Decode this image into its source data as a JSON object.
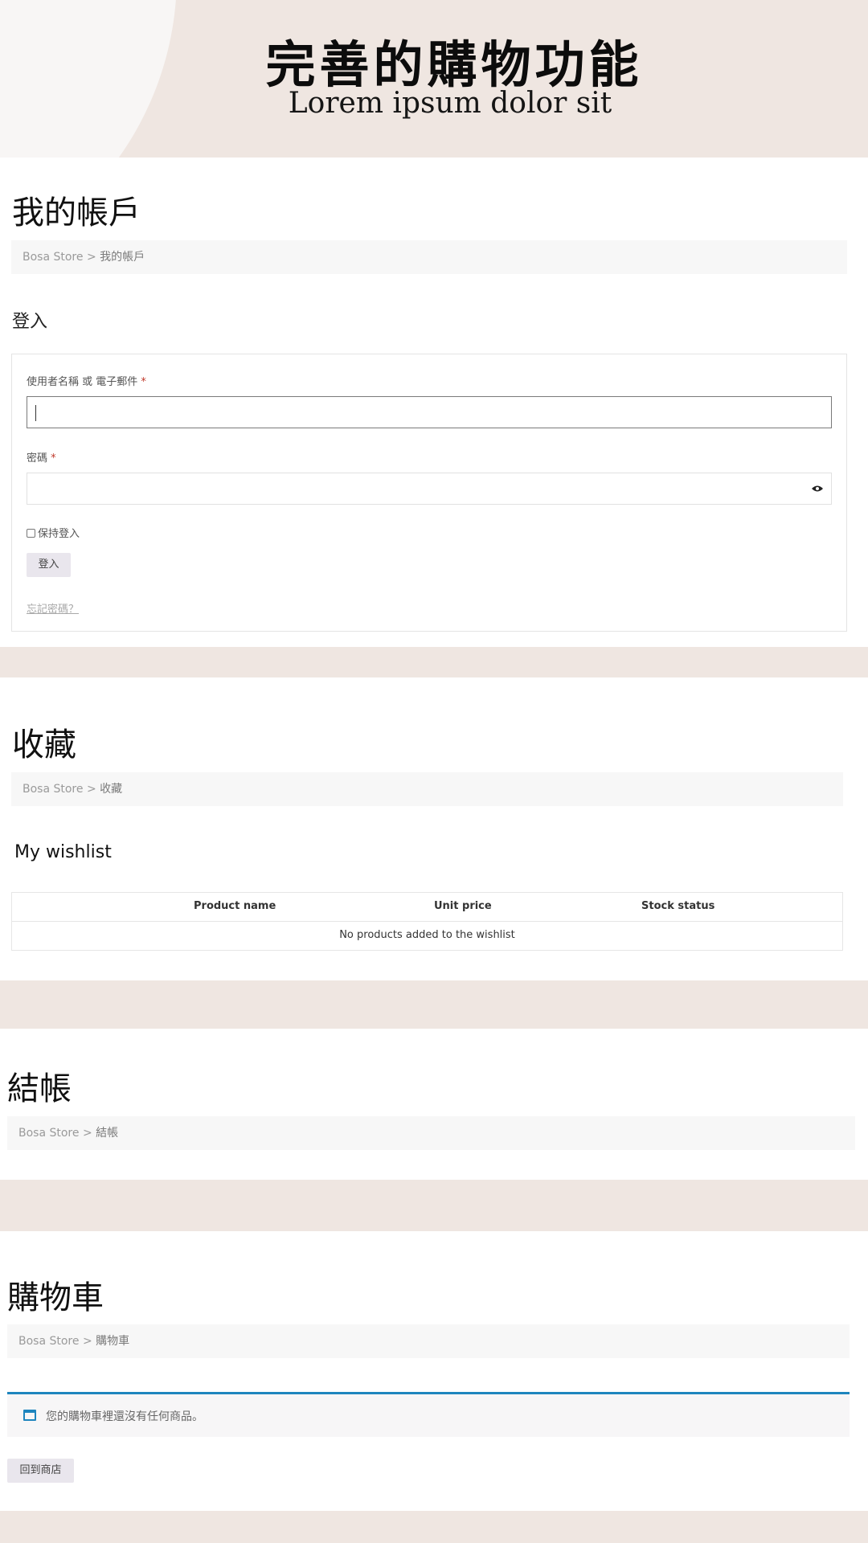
{
  "hero": {
    "title": "完善的購物功能",
    "subtitle": "Lorem ipsum dolor sit"
  },
  "account": {
    "title": "我的帳戶",
    "breadcrumb": {
      "home": "Bosa Store",
      "sep": ">",
      "current": "我的帳戶"
    },
    "login": {
      "heading": "登入",
      "username_label": "使用者名稱 或 電子郵件",
      "username_value": "",
      "password_label": "密碼",
      "password_value": "",
      "required_mark": "*",
      "remember_label": "保持登入",
      "remember_checked": false,
      "submit_label": "登入",
      "forgot_label": "忘記密碼？"
    }
  },
  "wishlist": {
    "title": "收藏",
    "breadcrumb": {
      "home": "Bosa Store",
      "sep": ">",
      "current": "收藏"
    },
    "heading": "My wishlist",
    "columns": [
      "Product name",
      "Unit price",
      "Stock status"
    ],
    "empty_message": "No products added to the wishlist"
  },
  "checkout": {
    "title": "結帳",
    "breadcrumb": {
      "home": "Bosa Store",
      "sep": ">",
      "current": "結帳"
    }
  },
  "cart": {
    "title": "購物車",
    "breadcrumb": {
      "home": "Bosa Store",
      "sep": ">",
      "current": "購物車"
    },
    "empty_notice": "您的購物車裡還沒有任何商品。",
    "return_button": "回到商店"
  },
  "colors": {
    "band": "#efe6e1",
    "accent_blue": "#1e85be",
    "required": "#c0392b"
  },
  "icons": {
    "password_toggle": "eye-icon",
    "notice": "window-icon"
  }
}
